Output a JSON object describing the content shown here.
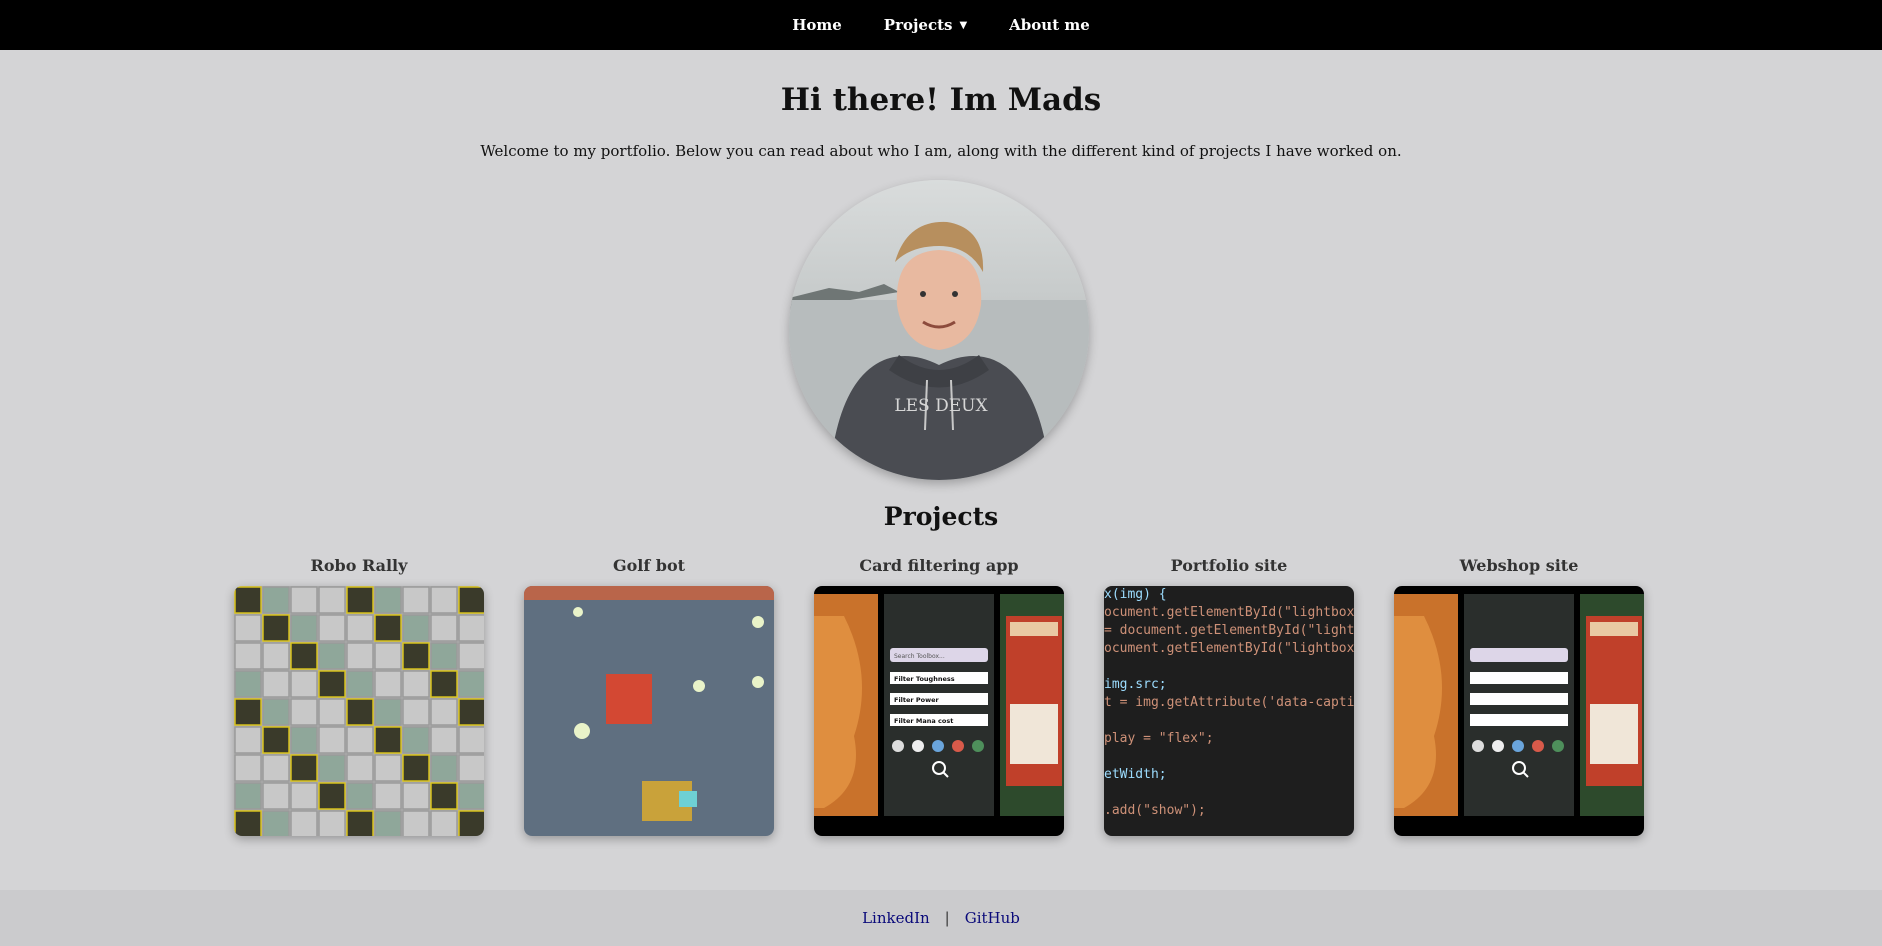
{
  "nav": {
    "items": [
      {
        "label": "Home"
      },
      {
        "label": "Projects",
        "has_dropdown": true
      },
      {
        "label": "About me"
      }
    ]
  },
  "hero": {
    "title": "Hi there! Im Mads",
    "subtitle": "Welcome to my portfolio. Below you can read about who I am, along with the different kind of projects I have worked on.",
    "avatar_shirt_text": "LES DEUX"
  },
  "projects": {
    "heading": "Projects",
    "items": [
      {
        "title": "Robo Rally"
      },
      {
        "title": "Golf bot"
      },
      {
        "title": "Card filtering app"
      },
      {
        "title": "Portfolio site"
      },
      {
        "title": "Webshop site"
      }
    ]
  },
  "app_screens": {
    "search_placeholder": "Search Toolbox...",
    "filters": [
      "Filter Toughness",
      "Filter Power",
      "Filter Mana cost"
    ]
  },
  "code_snippet": [
    "x(img) {",
    "ocument.getElementById(\"lightbox\");",
    "= document.getElementById(\"lightbox",
    "ocument.getElementById(\"lightbox-cap",
    "",
    "img.src;",
    "t = img.getAttribute('data-caption'",
    "",
    "play = \"flex\";",
    "",
    "etWidth;",
    "",
    ".add(\"show\");"
  ],
  "footer": {
    "links": [
      {
        "label": "LinkedIn"
      },
      {
        "label": "GitHub"
      }
    ],
    "separator": "|"
  },
  "colors": {
    "nav_bg": "#000000",
    "page_bg": "#d4d4d6",
    "footer_bg": "#cbcbcd",
    "link": "#0a0a7a"
  }
}
